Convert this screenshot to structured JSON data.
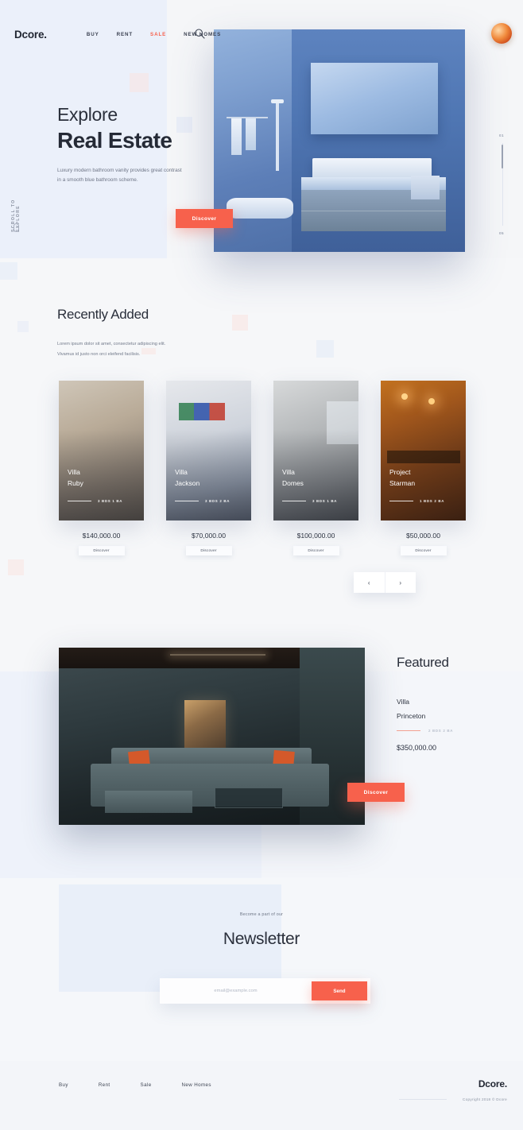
{
  "brand": "Dcore.",
  "nav": {
    "links": [
      {
        "label": "BUY",
        "accent": false
      },
      {
        "label": "RENT",
        "accent": false
      },
      {
        "label": "SALE",
        "accent": true
      },
      {
        "label": "NEW HOMES",
        "accent": false
      }
    ],
    "search_icon": "search-icon",
    "avatar": "user-avatar"
  },
  "hero": {
    "scroll_hint": "SCROLL TO EXPLORE",
    "title_line1": "Explore",
    "title_line2": "Real Estate",
    "subtitle_line1": "Luxury modern bathroom vanity provides great contrast",
    "subtitle_line2": "in a smooth blue bathroom scheme.",
    "cta": "Discover",
    "slider": {
      "current": "01",
      "total": "05"
    }
  },
  "recently_added": {
    "title": "Recently Added",
    "sub_line1": "Lorem ipsum dolor sit amet, consectetur adipiscing elit.",
    "sub_line2": "Vivamus id justo non orci eleifend facilisis.",
    "cards": [
      {
        "name_line1": "Villa",
        "name_line2": "Ruby",
        "meta": "3 BDS   1 BA",
        "price": "$140,000.00",
        "cta": "Discover"
      },
      {
        "name_line1": "Villa",
        "name_line2": "Jackson",
        "meta": "3 BDS   2 BA",
        "price": "$70,000.00",
        "cta": "Discover"
      },
      {
        "name_line1": "Villa",
        "name_line2": "Domes",
        "meta": "3 BDS   1 BA",
        "price": "$100,000.00",
        "cta": "Discover"
      },
      {
        "name_line1": "Project",
        "name_line2": "Starman",
        "meta": "1 BDS   2 BA",
        "price": "$50,000.00",
        "cta": "Discover"
      }
    ],
    "carousel": {
      "prev": "‹",
      "next": "›"
    }
  },
  "featured": {
    "title": "Featured",
    "name_line1": "Villa",
    "name_line2": "Princeton",
    "meta": "2 BDS   2 BA",
    "price": "$350,000.00",
    "cta": "Discover"
  },
  "newsletter": {
    "eyebrow": "Become a part of our",
    "title": "Newsletter",
    "placeholder": "email@example.com",
    "value": "",
    "send_label": "Send"
  },
  "footer": {
    "links": [
      "Buy",
      "Rent",
      "Sale",
      "New Homes"
    ],
    "brand": "Dcore.",
    "copyright": "Copyright 2018 © Dcore"
  },
  "colors": {
    "accent": "#f7614c",
    "ink": "#2a2f3b",
    "muted": "#727a8b",
    "bg": "#f5f7fa",
    "panel": "#e9eff9"
  }
}
